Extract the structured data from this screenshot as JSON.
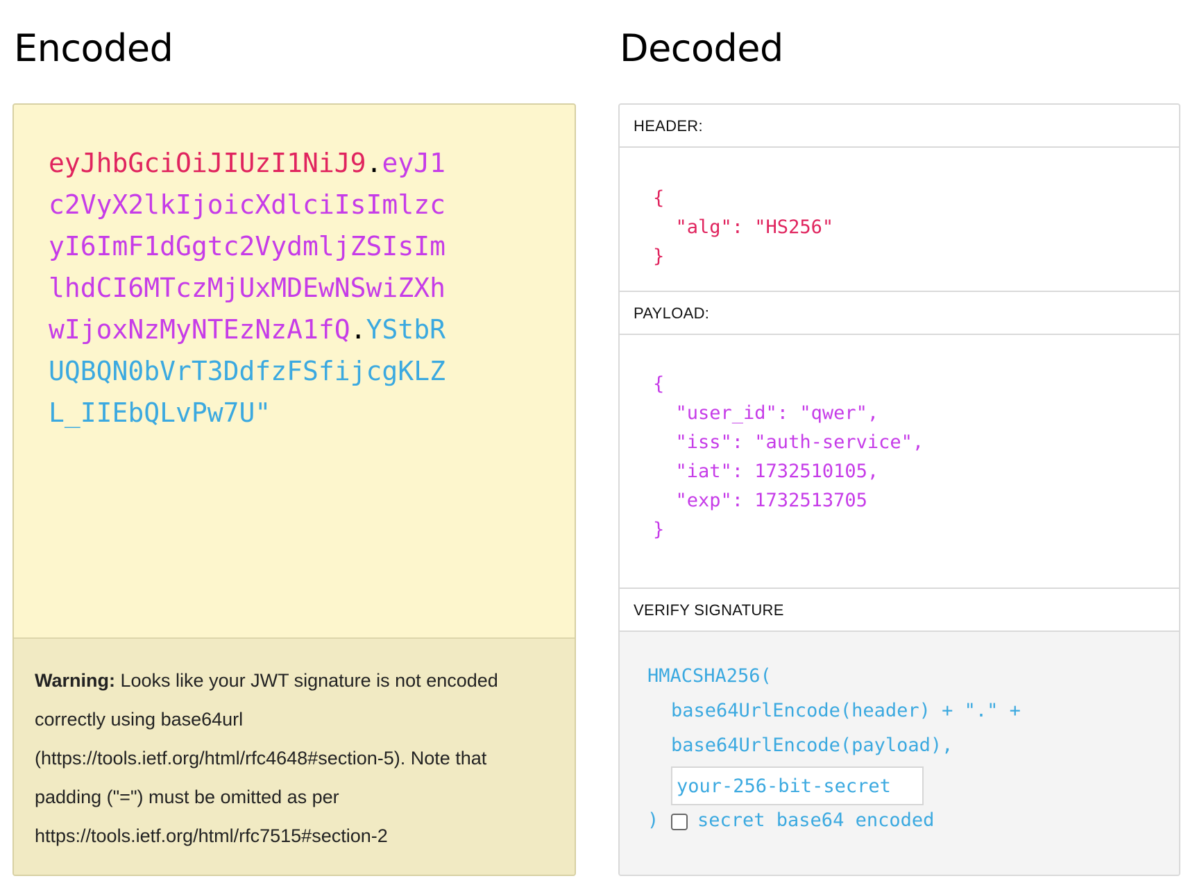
{
  "encoded": {
    "title": "Encoded",
    "token_header_part": "eyJhbGciOiJIUzI1NiJ9",
    "token_payload_part": "eyJ1\nc2VyX2lkIjoicXdlciIsImlzc\nyI6ImF1dGgtc2VydmljZSIsIm\nlhdCI6MTczMjUxMDEwNSwiZXh\nwIjoxNzMyNTEzNzA1fQ",
    "token_signature_part": "YStbR\nUQBQN0bVrT3DdfzFSfijcgKLZ\nL_IIEbQLvPw7U\"",
    "dot": ".",
    "warning_label": "Warning:",
    "warning_text": "Looks like your JWT signature is not encoded correctly using base64url (https://tools.ietf.org/html/rfc4648#section-5). Note that padding (\"=\") must be omitted as per https://tools.ietf.org/html/rfc7515#section-2"
  },
  "decoded": {
    "title": "Decoded",
    "header": {
      "label": "HEADER:",
      "json": "{\n  \"alg\": \"HS256\"\n}"
    },
    "payload": {
      "label": "PAYLOAD:",
      "json": "{\n  \"user_id\": \"qwer\",\n  \"iss\": \"auth-service\",\n  \"iat\": 1732510105,\n  \"exp\": 1732513705\n}"
    },
    "verify": {
      "label": "VERIFY SIGNATURE",
      "fn_open": "HMACSHA256(",
      "line1": "base64UrlEncode(header) + \".\" +",
      "line2": "base64UrlEncode(payload),",
      "secret_placeholder": "your-256-bit-secret",
      "close": ")",
      "checkbox_label": "secret base64 encoded"
    }
  },
  "colors": {
    "header": "#e0245e",
    "payload": "#c63ce8",
    "signature": "#3ba9e0"
  }
}
